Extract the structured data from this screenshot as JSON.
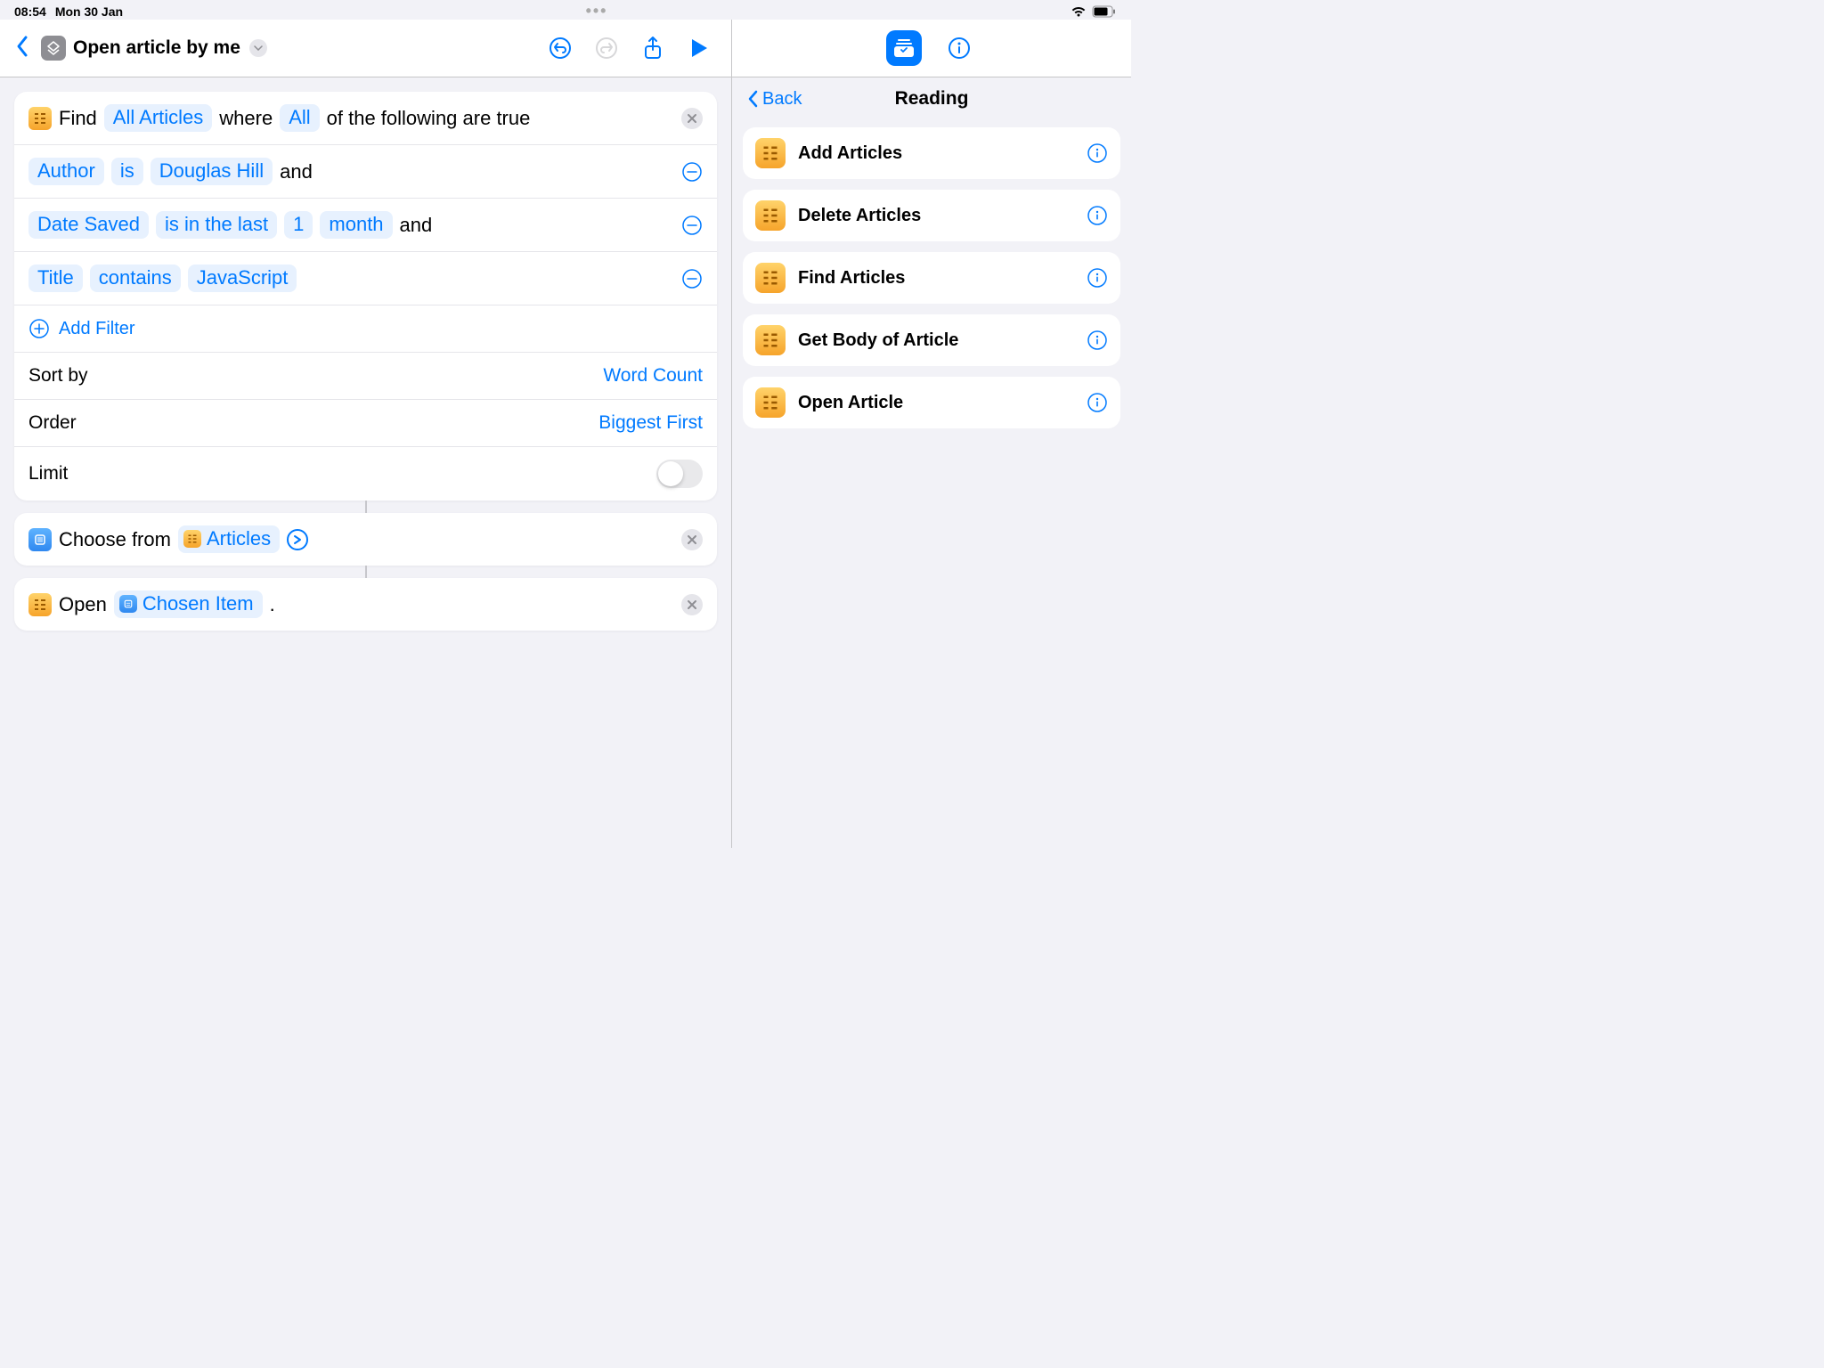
{
  "status": {
    "time": "08:54",
    "date": "Mon 30 Jan"
  },
  "header": {
    "title": "Open article by me"
  },
  "find": {
    "verb": "Find",
    "scope": "All Articles",
    "where": "where",
    "match": "All",
    "tail": "of the following are true",
    "filters": [
      {
        "field": "Author",
        "op": "is",
        "value": "Douglas Hill",
        "trail": "and"
      },
      {
        "field": "Date Saved",
        "op": "is in the last",
        "value": "1",
        "unit": "month",
        "trail": "and"
      },
      {
        "field": "Title",
        "op": "contains",
        "value": "JavaScript",
        "trail": ""
      }
    ],
    "add_filter": "Add Filter",
    "sort_label": "Sort by",
    "sort_value": "Word Count",
    "order_label": "Order",
    "order_value": "Biggest First",
    "limit_label": "Limit"
  },
  "choose": {
    "verb": "Choose from",
    "target": "Articles"
  },
  "open": {
    "verb": "Open",
    "target": "Chosen Item",
    "tail": "."
  },
  "right": {
    "back": "Back",
    "title": "Reading",
    "actions": [
      "Add Articles",
      "Delete Articles",
      "Find Articles",
      "Get Body of Article",
      "Open Article"
    ]
  }
}
